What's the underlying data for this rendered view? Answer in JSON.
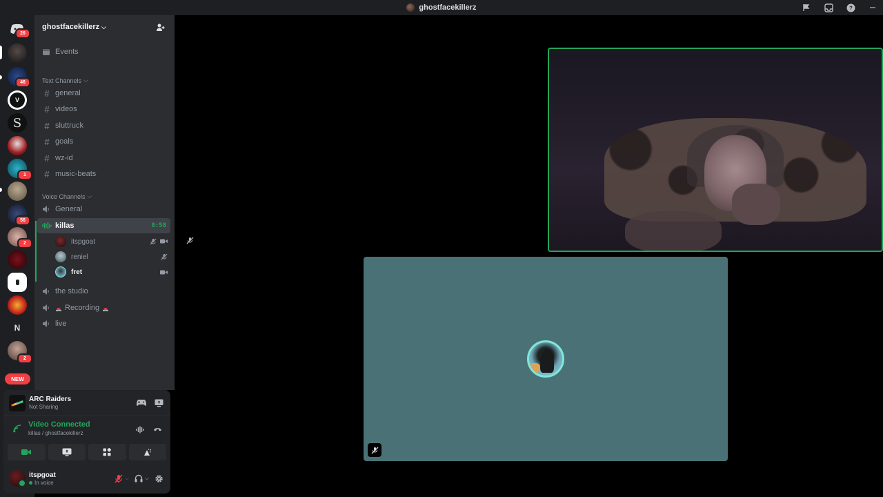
{
  "window": {
    "title": "ghostfacekillerz"
  },
  "rail": {
    "badges": [
      "26",
      "46",
      "1",
      "56",
      "2",
      "2"
    ],
    "letter_server": "N",
    "new_label": "NEW"
  },
  "guild": {
    "name": "ghostfacekillerz"
  },
  "sidebar": {
    "events_label": "Events",
    "text_category": "Text Channels",
    "text_channels": [
      "general",
      "videos",
      "sluttruck",
      "goals",
      "wz-id",
      "music-beats"
    ],
    "voice_category": "Voice Channels",
    "voice_channels": {
      "general": "General",
      "killas": "killas",
      "killas_timer": "8:58",
      "the_studio": "the studio",
      "recording": "Recording",
      "live": "live"
    },
    "voice_users": [
      "itspgoat",
      "reniel",
      "fret"
    ]
  },
  "activity": {
    "title": "ARC Raiders",
    "subtitle": "Not Sharing"
  },
  "voice_connection": {
    "title": "Video Connected",
    "subtitle": "killas / ghostfacekillerz"
  },
  "user": {
    "name": "itspgoat",
    "status": "In voice"
  },
  "colors": {
    "accent_green": "#23a55a",
    "danger_red": "#f23f43",
    "avatar_tile": "#4a7276"
  }
}
